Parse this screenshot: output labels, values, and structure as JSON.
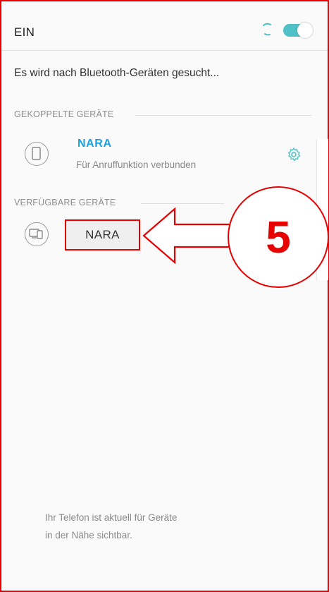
{
  "header": {
    "state_label": "EIN",
    "toggle_on": true,
    "accent": "#4fc1c6"
  },
  "status_text": "Es wird nach Bluetooth-Geräten gesucht...",
  "paired": {
    "section_title": "GEKOPPELTE GERÄTE",
    "device_name": "NARA",
    "device_status": "Für Anruffunktion verbunden",
    "icon": "phone-icon",
    "settings_icon": "gear-icon"
  },
  "available": {
    "section_title": "VERFÜGBARE GERÄTE",
    "device_name": "NARA",
    "icon": "devices-icon"
  },
  "annotation": {
    "step_number": "5",
    "color": "#e60000"
  },
  "footer": {
    "line1": "Ihr Telefon ist aktuell für Geräte",
    "line2": "in der Nähe sichtbar."
  }
}
